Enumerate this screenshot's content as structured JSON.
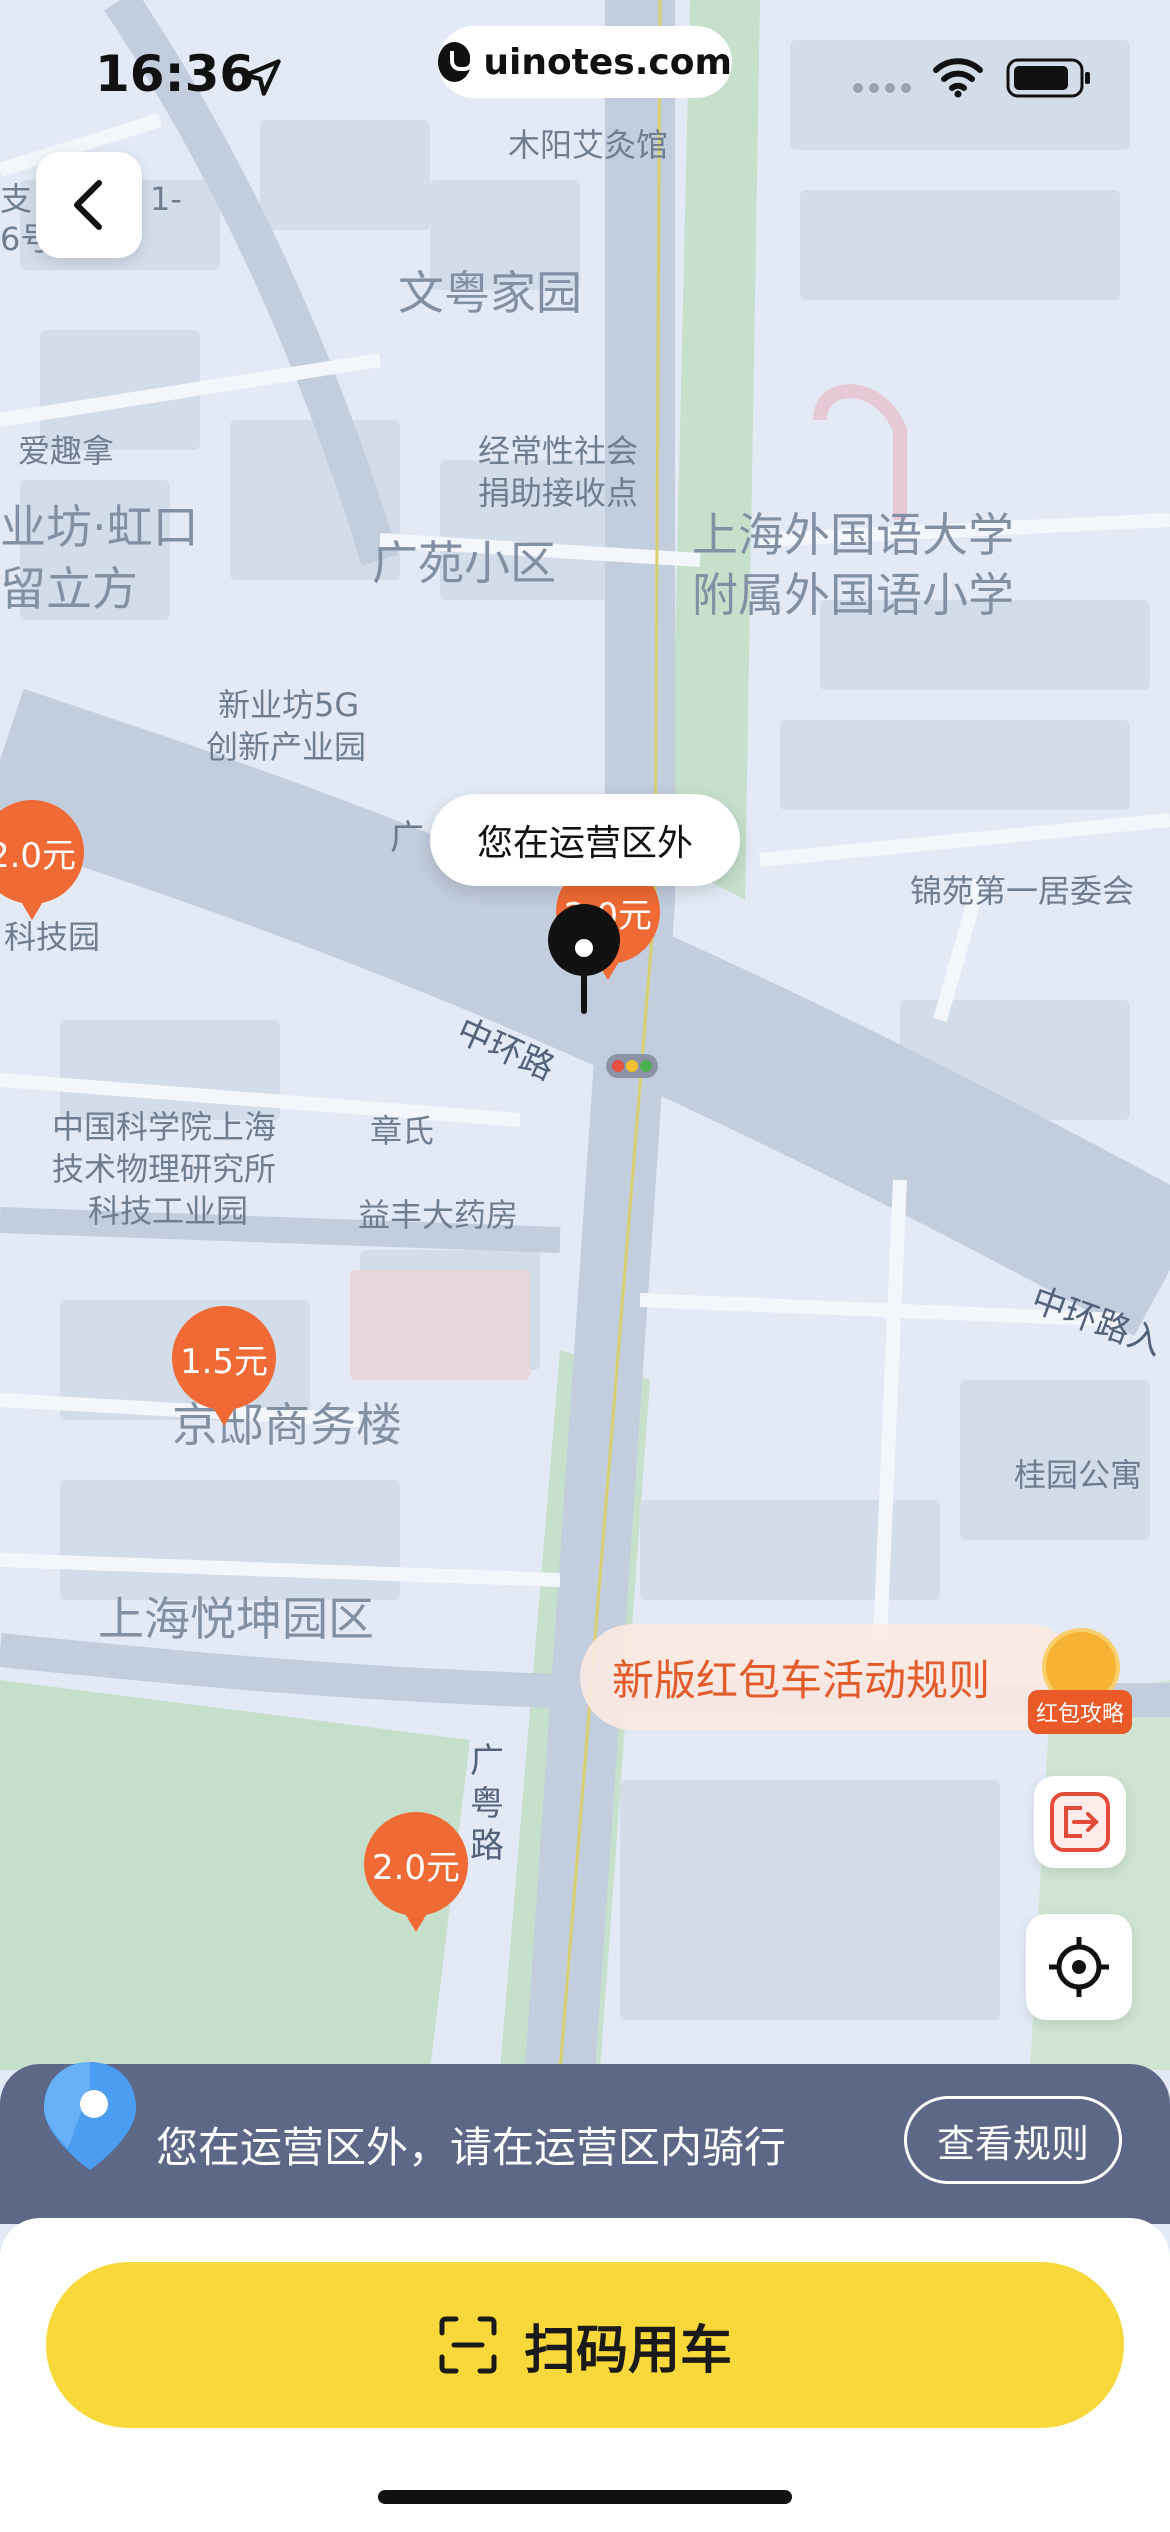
{
  "status_bar": {
    "time": "16:36",
    "url": "uinotes.com"
  },
  "map": {
    "labels": {
      "mu_yang": "木阳艾灸馆",
      "wen_yue": "文粤家园",
      "ai_qu_na": "爱趣拿",
      "jing_chang": "经常性社会",
      "jing_chang_2": "捐助接收点",
      "ye_fang": "业坊·虹口",
      "liu_li": "留立方",
      "guang_yuan": "广苑小区",
      "school_1": "上海外国语大学",
      "school_2": "附属外国语小学",
      "xin_ye_1": "新业坊5G",
      "xin_ye_2": "创新产业园",
      "guang_partial": "广",
      "ke_ji_yuan": "科技园",
      "jin_yuan": "锦苑第一居委会",
      "zhong_huan": "中环路",
      "zhong_huan_2": "中环路入",
      "cas_1": "中国科学院上海",
      "cas_2": "技术物理研究所",
      "cas_3": "科技工业园",
      "zhang_shi": "章氏",
      "yi_feng": "益丰大药房",
      "jing_you": "京邸商务楼",
      "gui_yuan": "桂园公寓",
      "yue_kun": "上海悦坤园区",
      "guang_yue_road": "广粤路",
      "top_left_1": "支",
      "top_left_2": "6号",
      "top_left_3": "1-"
    },
    "pin_bubble": "您在运营区外",
    "prices": [
      {
        "label": "2.0元"
      },
      {
        "label": "2.0元"
      },
      {
        "label": "1.5元"
      },
      {
        "label": "2.0元"
      }
    ]
  },
  "promo": {
    "rules_text": "新版红包车活动规则",
    "hongbao_tag": "红包攻略"
  },
  "notice": {
    "text": "您在运营区外，请在运营区内骑行",
    "rules_button": "查看规则"
  },
  "bottom": {
    "scan_label": "扫码用车"
  },
  "colors": {
    "accent_yellow": "#f8d83a",
    "price_orange": "#ef6a34",
    "notice_bg": "#5d6786"
  }
}
